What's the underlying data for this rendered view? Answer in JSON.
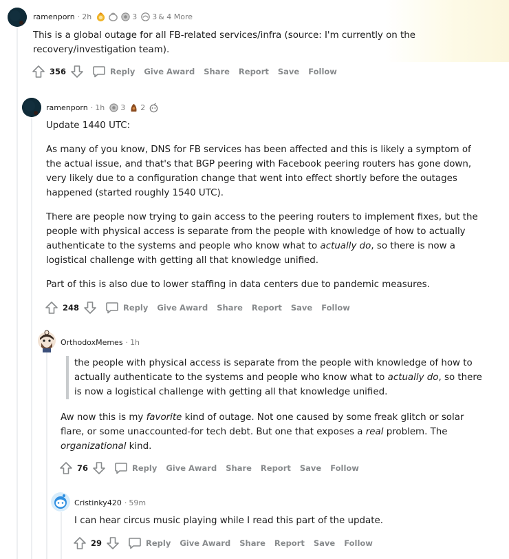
{
  "comments": [
    {
      "author": "ramenporn",
      "time": "2h",
      "awards_count_1": "3",
      "awards_count_2": "3",
      "more_awards": "& 4 More",
      "body": "This is a global outage for all FB-related services/infra (source: I'm currently on the recovery/investigation team).",
      "score": "356"
    },
    {
      "author": "ramenporn",
      "time": "1h",
      "awards_count_1": "3",
      "awards_count_2": "2",
      "paragraphs": [
        "Update 1440 UTC:",
        "As many of you know, DNS for FB services has been affected and this is likely a symptom of the actual issue, and that's that BGP peering with Facebook peering routers has gone down, very likely due to a configuration change that went into effect shortly before the outages happened (started roughly 1540 UTC).",
        "Part of this is also due to lower staffing in data centers due to pandemic measures."
      ],
      "p3_a": "There are people now trying to gain access to the peering routers to implement fixes, but the people with physical access is separate from the people with knowledge of how to actually authenticate to the systems and people who know what to ",
      "p3_em": "actually do",
      "p3_b": ", so there is now a logistical challenge with getting all that knowledge unified.",
      "score": "248"
    },
    {
      "author": "OrthodoxMemes",
      "time": "1h",
      "quote_a": "the people with physical access is separate from the people with knowledge of how to actually authenticate to the systems and people who know what to ",
      "quote_em": "actually do",
      "quote_b": ", so there is now a logistical challenge with getting all that knowledge unified.",
      "body_a": "Aw now this is my ",
      "body_em1": "favorite",
      "body_b": " kind of outage. Not one caused by some freak glitch or solar flare, or some unaccounted-for tech debt. But one that exposes a ",
      "body_em2": "real",
      "body_c": " problem. The ",
      "body_em3": "organizational",
      "body_d": " kind.",
      "score": "76"
    },
    {
      "author": "Cristinky420",
      "time": "59m",
      "body": "I can hear circus music playing while I read this part of the update.",
      "score": "29"
    }
  ],
  "actions": {
    "reply": "Reply",
    "give_award": "Give Award",
    "share": "Share",
    "report": "Report",
    "save": "Save",
    "follow": "Follow"
  },
  "separator": "·",
  "colors": {
    "text": "#1c1c1c",
    "meta": "#7c7c7c",
    "action": "#878a8c",
    "thread": "#edeff1",
    "quote_bar": "#c8cbcd"
  }
}
